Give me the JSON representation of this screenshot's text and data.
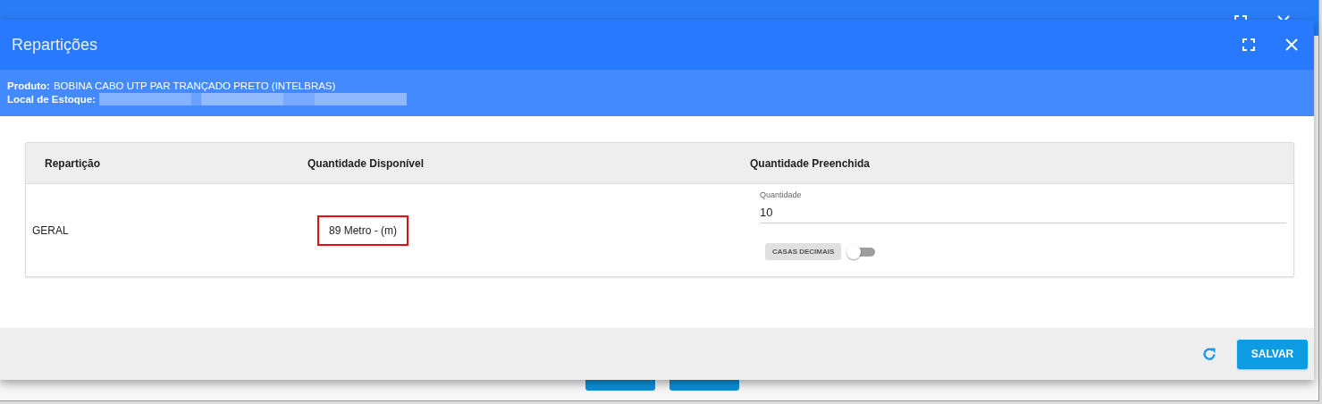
{
  "background_window": {
    "buttons": [
      {
        "kind": "blank"
      },
      {
        "kind": "blank"
      }
    ]
  },
  "dialog": {
    "title": "Repartições",
    "info": [
      {
        "label": "Produto:",
        "value": "BOBINA CABO UTP PAR TRANÇADO PRETO (INTELBRAS)",
        "redacted": false
      },
      {
        "label": "Local de Estoque:",
        "redacted": true
      }
    ],
    "table": {
      "columns": [
        "Repartição",
        "Quantidade Disponível",
        "Quantidade Preenchida"
      ],
      "rows": [
        {
          "name": "GERAL",
          "available": "89 Metro - (m)",
          "highlighted": true,
          "quantity": {
            "label": "Quantidade",
            "value": "10"
          },
          "decimals": {
            "label": "CASAS DECIMAIS",
            "on": false
          }
        }
      ]
    },
    "footer": {
      "save": "SALVAR"
    }
  }
}
